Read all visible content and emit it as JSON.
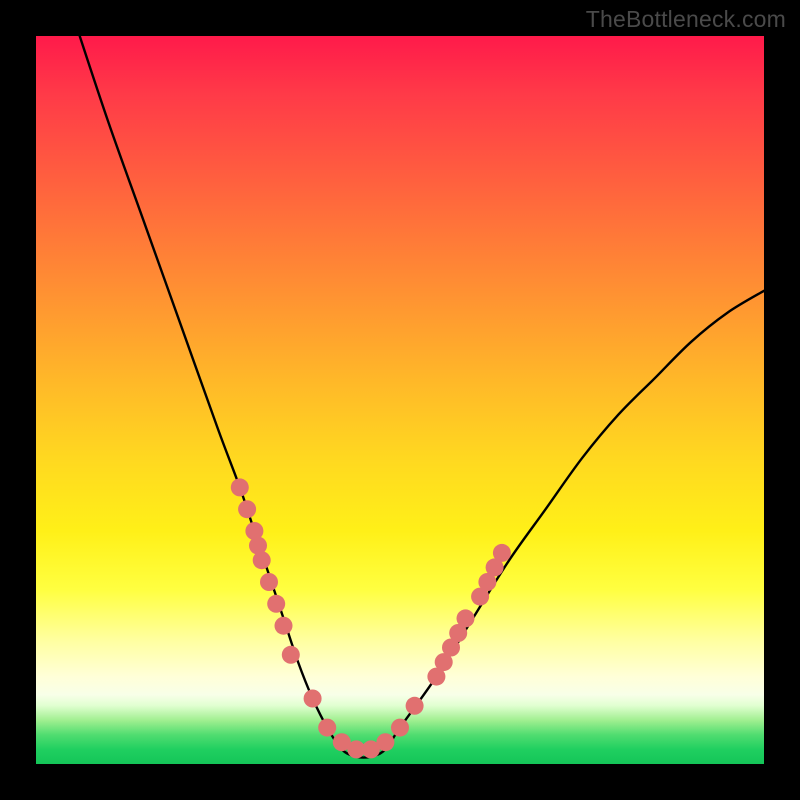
{
  "watermark": "TheBottleneck.com",
  "chart_data": {
    "type": "line",
    "title": "",
    "xlabel": "",
    "ylabel": "",
    "xlim": [
      0,
      100
    ],
    "ylim": [
      0,
      100
    ],
    "series": [
      {
        "name": "bottleneck-curve",
        "x": [
          6,
          10,
          15,
          20,
          25,
          28,
          30,
          32,
          34,
          36,
          38,
          40,
          42,
          44,
          46,
          48,
          50,
          55,
          60,
          65,
          70,
          75,
          80,
          85,
          90,
          95,
          100
        ],
        "values": [
          100,
          88,
          74,
          60,
          46,
          38,
          32,
          26,
          20,
          14,
          9,
          5,
          2,
          1,
          1,
          2,
          5,
          12,
          20,
          28,
          35,
          42,
          48,
          53,
          58,
          62,
          65
        ]
      }
    ],
    "markers": {
      "name": "highlight-dots",
      "color": "#e17070",
      "radius_px": 9,
      "points_xy": [
        [
          28,
          38
        ],
        [
          29,
          35
        ],
        [
          30,
          32
        ],
        [
          30.5,
          30
        ],
        [
          31,
          28
        ],
        [
          32,
          25
        ],
        [
          33,
          22
        ],
        [
          34,
          19
        ],
        [
          35,
          15
        ],
        [
          38,
          9
        ],
        [
          40,
          5
        ],
        [
          42,
          3
        ],
        [
          44,
          2
        ],
        [
          46,
          2
        ],
        [
          48,
          3
        ],
        [
          50,
          5
        ],
        [
          52,
          8
        ],
        [
          55,
          12
        ],
        [
          56,
          14
        ],
        [
          57,
          16
        ],
        [
          58,
          18
        ],
        [
          59,
          20
        ],
        [
          61,
          23
        ],
        [
          62,
          25
        ],
        [
          63,
          27
        ],
        [
          64,
          29
        ]
      ]
    }
  }
}
